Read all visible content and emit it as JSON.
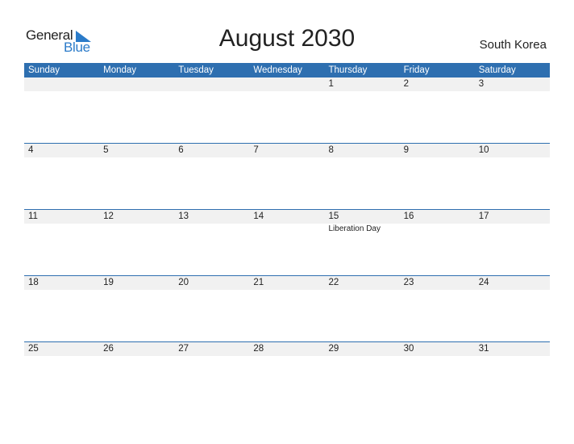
{
  "logo": {
    "part1": "General",
    "part2": "Blue"
  },
  "title": "August 2030",
  "country": "South Korea",
  "colors": {
    "accent": "#2e6fb0",
    "logo_blue": "#2b7bc9",
    "date_strip": "#f1f1f1"
  },
  "weekdays": [
    "Sunday",
    "Monday",
    "Tuesday",
    "Wednesday",
    "Thursday",
    "Friday",
    "Saturday"
  ],
  "weeks": [
    {
      "days": [
        "",
        "",
        "",
        "",
        "1",
        "2",
        "3"
      ],
      "events": [
        "",
        "",
        "",
        "",
        "",
        "",
        ""
      ]
    },
    {
      "days": [
        "4",
        "5",
        "6",
        "7",
        "8",
        "9",
        "10"
      ],
      "events": [
        "",
        "",
        "",
        "",
        "",
        "",
        ""
      ]
    },
    {
      "days": [
        "11",
        "12",
        "13",
        "14",
        "15",
        "16",
        "17"
      ],
      "events": [
        "",
        "",
        "",
        "",
        "Liberation Day",
        "",
        ""
      ]
    },
    {
      "days": [
        "18",
        "19",
        "20",
        "21",
        "22",
        "23",
        "24"
      ],
      "events": [
        "",
        "",
        "",
        "",
        "",
        "",
        ""
      ]
    },
    {
      "days": [
        "25",
        "26",
        "27",
        "28",
        "29",
        "30",
        "31"
      ],
      "events": [
        "",
        "",
        "",
        "",
        "",
        "",
        ""
      ]
    }
  ]
}
